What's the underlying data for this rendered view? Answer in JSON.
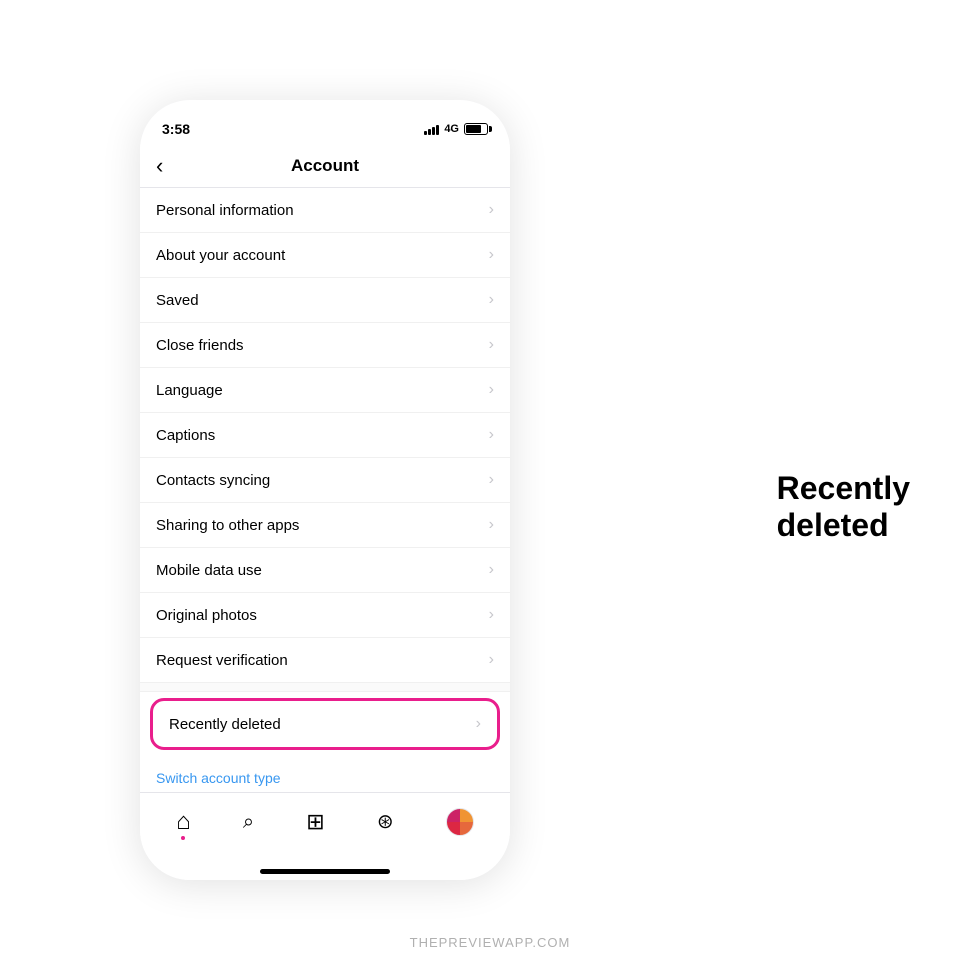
{
  "phone": {
    "status": {
      "time": "3:58",
      "signal_label": "4G"
    },
    "nav": {
      "back_symbol": "‹",
      "title": "Account"
    },
    "menu_items": [
      {
        "label": "Personal information"
      },
      {
        "label": "About your account"
      },
      {
        "label": "Saved"
      },
      {
        "label": "Close friends"
      },
      {
        "label": "Language"
      },
      {
        "label": "Captions"
      },
      {
        "label": "Contacts syncing"
      },
      {
        "label": "Sharing to other apps"
      },
      {
        "label": "Mobile data use"
      },
      {
        "label": "Original photos"
      },
      {
        "label": "Request verification"
      }
    ],
    "highlighted_item": {
      "label": "Recently deleted"
    },
    "switch_account": "Switch account type",
    "bottom_nav": {
      "home": "⌂",
      "search": "🔍",
      "reels": "▶",
      "shop": "🛍",
      "profile": "avatar"
    }
  },
  "annotation": {
    "line1": "Recently",
    "line2": "deleted"
  },
  "footer": "THEPREVIEWAPP.COM",
  "colors": {
    "highlight_border": "#e91e8c",
    "link_color": "#3897f0",
    "chevron_color": "#c7c7cc"
  }
}
